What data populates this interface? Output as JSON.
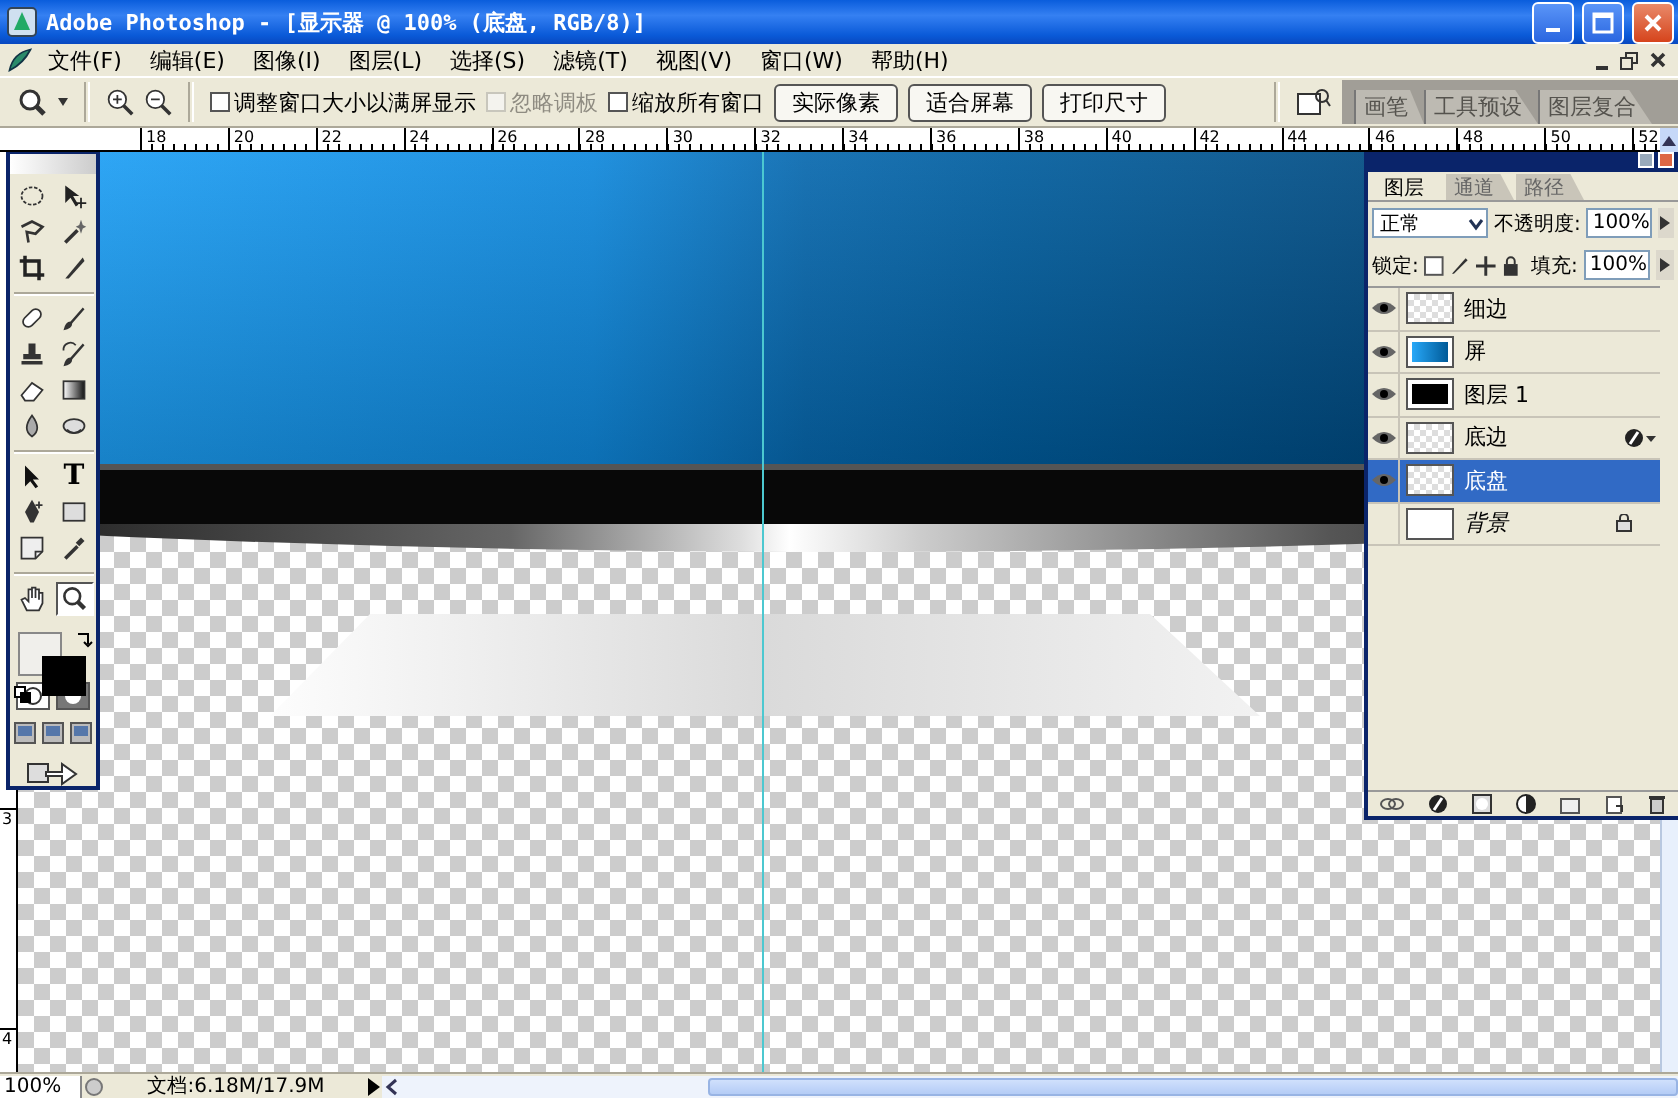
{
  "window": {
    "title": "Adobe Photoshop - [显示器 @ 100% (底盘, RGB/8)]"
  },
  "menu": [
    "文件(F)",
    "编辑(E)",
    "图像(I)",
    "图层(L)",
    "选择(S)",
    "滤镜(T)",
    "视图(V)",
    "窗口(W)",
    "帮助(H)"
  ],
  "options_bar": {
    "checkboxes": [
      {
        "label": "调整窗口大小以满屏显示",
        "checked": false,
        "disabled": false
      },
      {
        "label": "忽略调板",
        "checked": false,
        "disabled": true
      },
      {
        "label": "缩放所有窗口",
        "checked": false,
        "disabled": false
      }
    ],
    "buttons": [
      "实际像素",
      "适合屏幕",
      "打印尺寸"
    ],
    "palette_well_tabs": [
      "画笔",
      "工具预设",
      "图层复合"
    ]
  },
  "rulers": {
    "top_labels": [
      "18",
      "20",
      "22",
      "24",
      "26",
      "28",
      "30",
      "32",
      "34",
      "36",
      "38",
      "40",
      "42",
      "44",
      "46",
      "48",
      "50",
      "52"
    ],
    "left_labels": [
      "3",
      "4"
    ]
  },
  "toolbox": {
    "type_tool_label": "T",
    "tools": [
      {
        "kind": "marquee",
        "selected": false
      },
      {
        "kind": "move",
        "selected": false
      },
      {
        "kind": "lasso",
        "selected": false
      },
      {
        "kind": "wand",
        "selected": false
      },
      {
        "kind": "crop",
        "selected": false
      },
      {
        "kind": "slice",
        "selected": false
      },
      {
        "kind": "healing",
        "selected": false
      },
      {
        "kind": "brush",
        "selected": false
      },
      {
        "kind": "stamp",
        "selected": false
      },
      {
        "kind": "history",
        "selected": false
      },
      {
        "kind": "eraser",
        "selected": false
      },
      {
        "kind": "gradient",
        "selected": false
      },
      {
        "kind": "blur",
        "selected": false
      },
      {
        "kind": "dodge",
        "selected": false
      },
      {
        "kind": "path_select",
        "selected": false
      },
      {
        "kind": "type",
        "selected": false
      },
      {
        "kind": "pen",
        "selected": false
      },
      {
        "kind": "shape",
        "selected": false
      },
      {
        "kind": "notes",
        "selected": false
      },
      {
        "kind": "eyedropper",
        "selected": false
      },
      {
        "kind": "hand",
        "selected": false
      },
      {
        "kind": "zoom",
        "selected": true
      }
    ]
  },
  "layers_panel": {
    "tabs": [
      {
        "label": "图层",
        "selected": true
      },
      {
        "label": "通道",
        "selected": false
      },
      {
        "label": "路径",
        "selected": false
      }
    ],
    "blend_mode": "正常",
    "opacity_label": "不透明度:",
    "opacity": "100%",
    "lock_label": "锁定:",
    "fill_label": "填充:",
    "fill": "100%",
    "layers": [
      {
        "name": "细边",
        "kind": "transparent",
        "visible": true,
        "selected": false,
        "effects": false
      },
      {
        "name": "屏",
        "kind": "blue_image",
        "visible": true,
        "selected": false,
        "effects": false
      },
      {
        "name": "图层 1",
        "kind": "black_image",
        "visible": true,
        "selected": false,
        "effects": false
      },
      {
        "name": "底边",
        "kind": "transparent",
        "visible": true,
        "selected": false,
        "effects": true
      },
      {
        "name": "底盘",
        "kind": "transparent",
        "visible": true,
        "selected": true,
        "effects": false
      },
      {
        "name": "背景",
        "kind": "background",
        "visible": false,
        "selected": false,
        "effects": false
      }
    ]
  },
  "status_bar": {
    "zoom": "100%",
    "doc_info": "文档:6.18M/17.9M"
  }
}
